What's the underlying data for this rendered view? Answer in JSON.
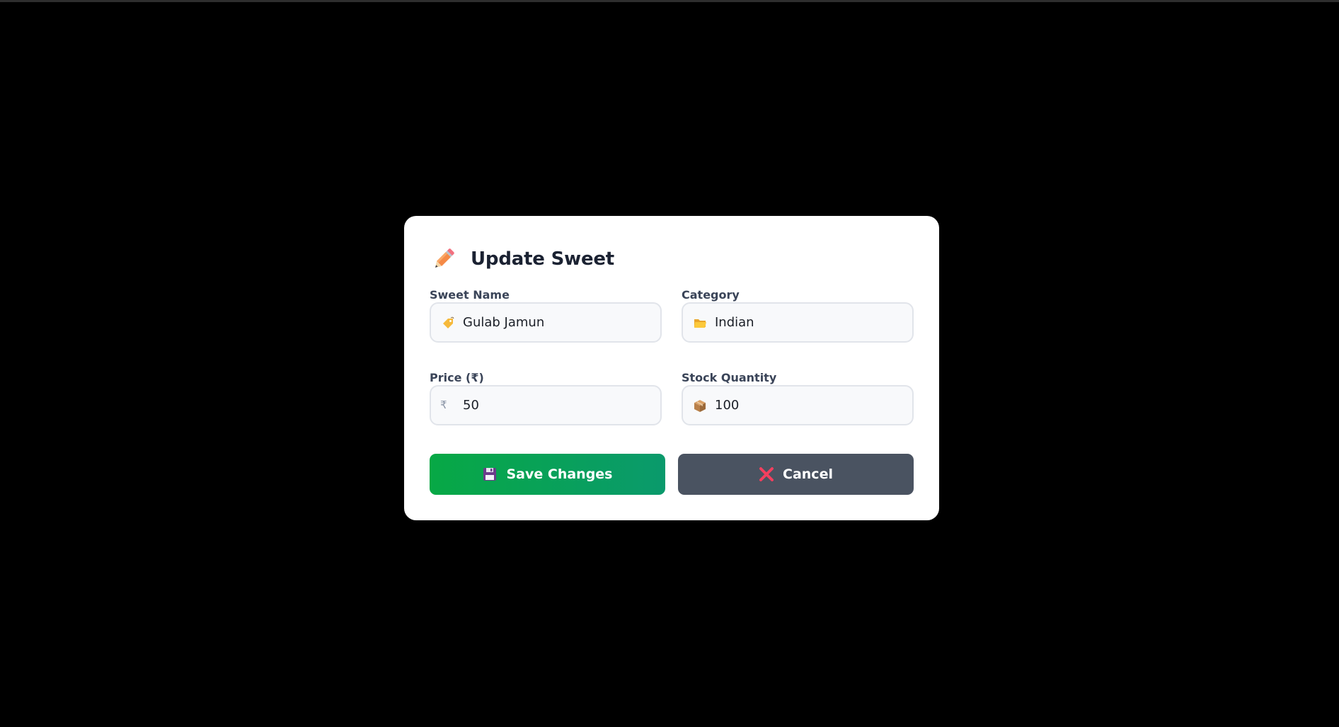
{
  "dialog": {
    "title": "Update Sweet",
    "title_icon": "pencil-icon"
  },
  "fields": {
    "sweet_name": {
      "label": "Sweet Name",
      "value": "Gulab Jamun",
      "icon": "tag-icon"
    },
    "category": {
      "label": "Category",
      "value": "Indian",
      "icon": "folder-icon"
    },
    "price": {
      "label": "Price (₹)",
      "value": "50",
      "icon": "rupee-icon",
      "icon_glyph": "₹"
    },
    "stock": {
      "label": "Stock Quantity",
      "value": "100",
      "icon": "package-icon"
    }
  },
  "actions": {
    "save_label": "Save Changes",
    "save_icon": "floppy-disk-icon",
    "cancel_label": "Cancel",
    "cancel_icon": "cross-mark-icon"
  },
  "colors": {
    "background": "#000000",
    "dialog": "#ffffff",
    "save_start": "#07a845",
    "save_end": "#0a9a6c",
    "cancel": "#4a5361",
    "cancel_icon": "#f43f5e",
    "title_text": "#1b2232"
  }
}
